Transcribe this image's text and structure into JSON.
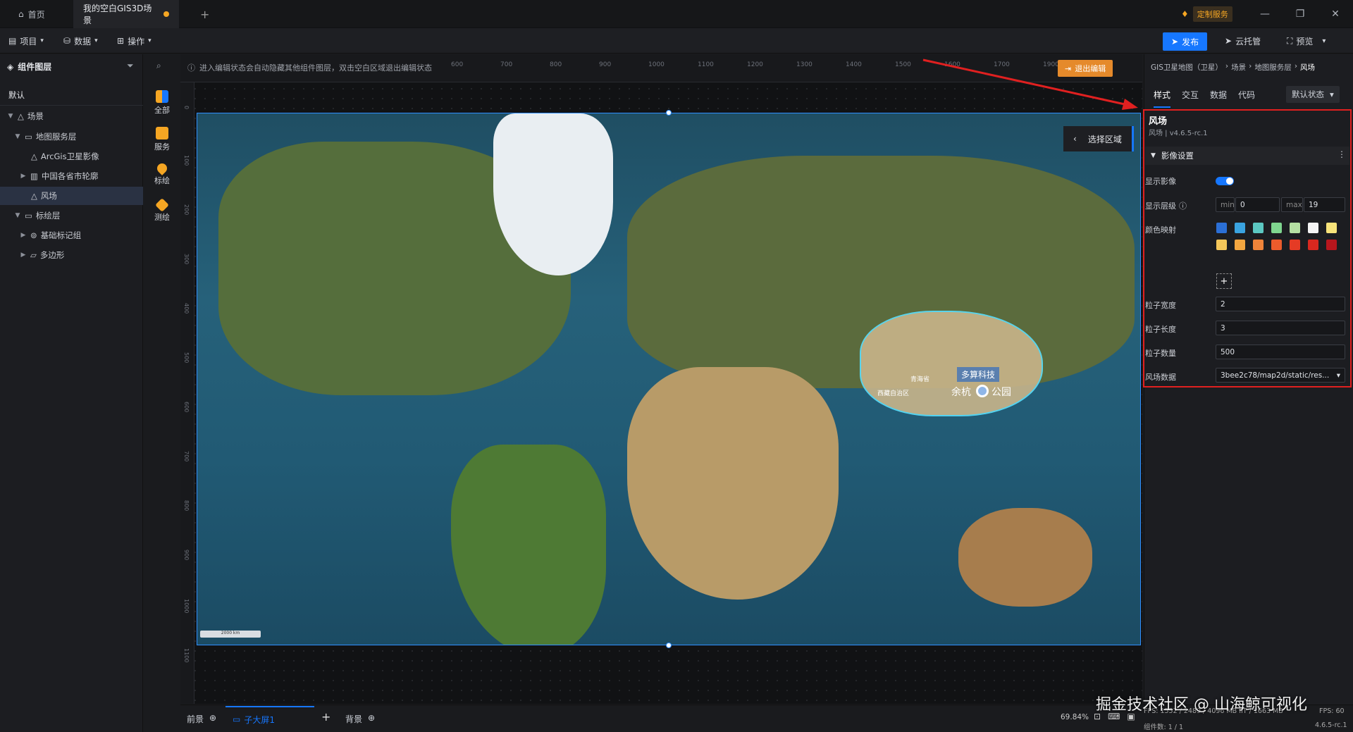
{
  "titlebar": {
    "home_tab": "首页",
    "project_tab": "我的空白GIS3D场景",
    "custom_service": "定制服务"
  },
  "toolbar": {
    "menu_project": "项目",
    "menu_data": "数据",
    "menu_operate": "操作",
    "publish": "发布",
    "cloud_host": "云托管",
    "preview": "预览"
  },
  "left": {
    "title": "组件图层",
    "tab_default": "默认",
    "tree": [
      {
        "label": "场景"
      },
      {
        "label": "地图服务层"
      },
      {
        "label": "ArcGis卫星影像"
      },
      {
        "label": "中国各省市轮廓"
      },
      {
        "label": "风场"
      },
      {
        "label": "标绘层"
      },
      {
        "label": "基础标记组"
      },
      {
        "label": "多边形"
      }
    ],
    "tools": [
      {
        "label": "全部"
      },
      {
        "label": "服务"
      },
      {
        "label": "标绘"
      },
      {
        "label": "测绘"
      }
    ]
  },
  "canvas": {
    "hint": "进入编辑状态会自动隐藏其他组件图层，双击空白区域退出编辑状态",
    "exit_edit": "退出编辑",
    "select_area": "选择区域",
    "ruler_top": [
      "600",
      "700",
      "800",
      "900",
      "1000",
      "1100",
      "1200",
      "1300",
      "1400",
      "1500",
      "1600",
      "1700",
      "1900"
    ],
    "ruler_left": [
      "0",
      "100",
      "200",
      "300",
      "400",
      "500",
      "600",
      "700",
      "800",
      "900",
      "1000",
      "1100"
    ],
    "scale_label": "2000 km",
    "map_labels": {
      "company": "多算科技",
      "yuhang": "余杭",
      "park": "公园",
      "qinghai": "青海省",
      "xizang": "西藏自治区"
    }
  },
  "right": {
    "breadcrumb": [
      "GIS卫星地图（卫星）",
      "场景",
      "地图服务层",
      "风场"
    ],
    "tabs": [
      "样式",
      "交互",
      "数据",
      "代码"
    ],
    "state_select": "默认状态",
    "component_title": "风场",
    "component_subtitle": "风场 | v4.6.5-rc.1",
    "section": "影像设置",
    "labels": {
      "show_image": "显示影像",
      "show_level": "显示层级",
      "color_map": "颜色映射",
      "particle_width": "粒子宽度",
      "particle_length": "粒子长度",
      "particle_count": "粒子数量",
      "wind_data": "风场数据"
    },
    "values": {
      "min_label": "min",
      "min": "0",
      "max_label": "max",
      "max": "19",
      "particle_width": "2",
      "particle_length": "3",
      "particle_count": "500",
      "wind_data": "3bee2c78/map2d/static/res..."
    },
    "colors": [
      "#2b6fd6",
      "#3aa3e0",
      "#5cc8c2",
      "#7fd68f",
      "#b5e0a3",
      "#f4f4f4",
      "#f7e37a",
      "#f5c75a",
      "#f3a640",
      "#f0843a",
      "#ec5b2c",
      "#e53b25",
      "#d9281f",
      "#b8161d"
    ],
    "add_symbol": "+"
  },
  "bottom": {
    "front": "前景",
    "child_screen": "子大屏1",
    "add": "+",
    "background": "背景",
    "zoom": "69.84%",
    "stats": "FPS: 1552 / 2489 / 4096 MB  IIT / 1663 MB",
    "fps": "FPS: 60",
    "component_count": "组件数: 1 / 1",
    "version": "4.6.5-rc.1"
  },
  "watermark": "掘金技术社区 @ 山海鲸可视化"
}
